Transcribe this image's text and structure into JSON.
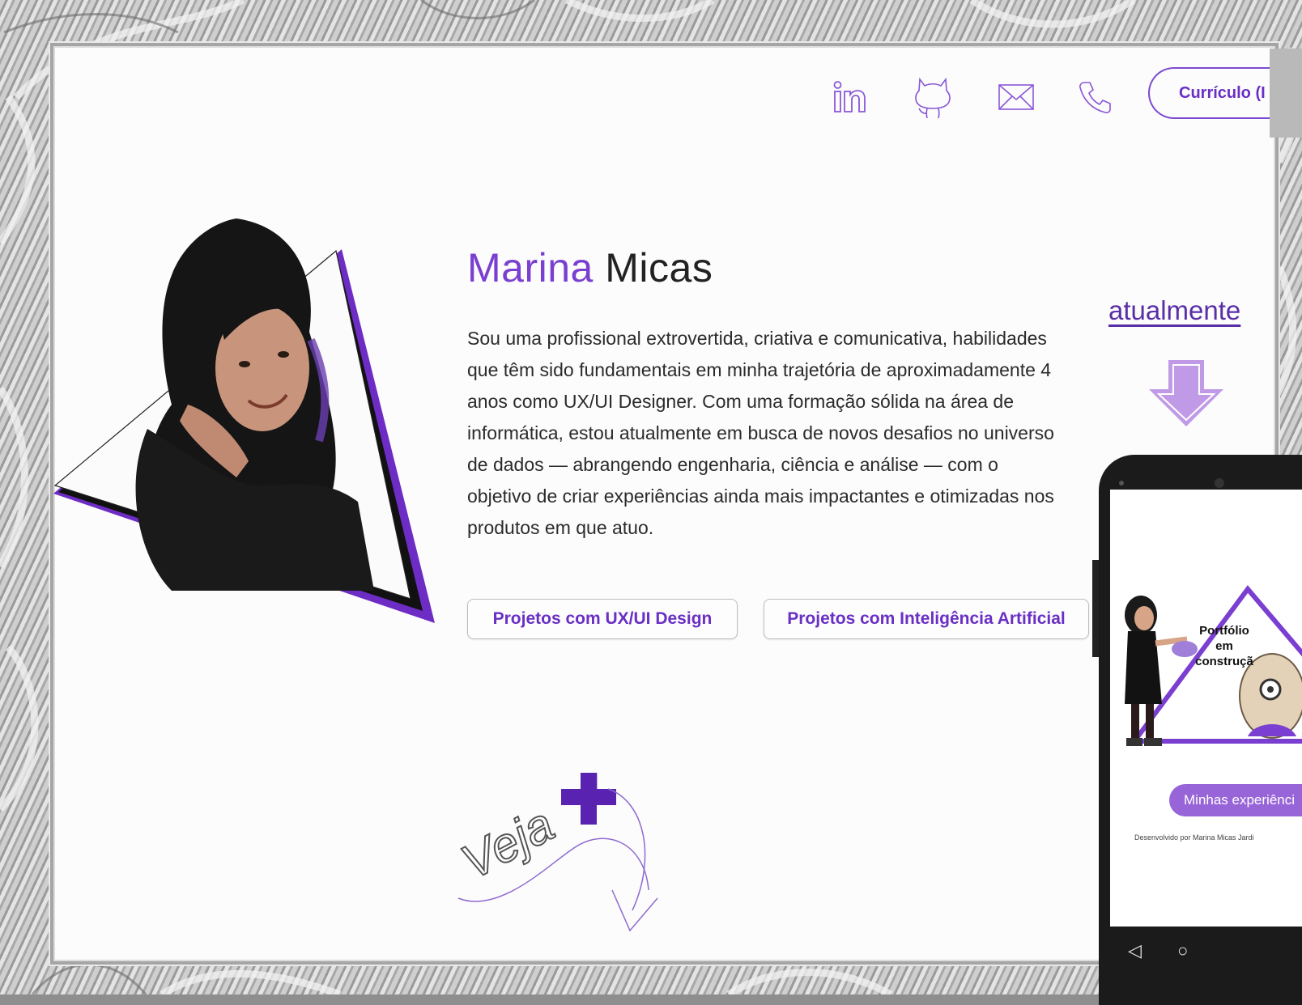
{
  "header": {
    "social": [
      {
        "name": "linkedin-icon"
      },
      {
        "name": "github-icon"
      },
      {
        "name": "mail-icon"
      },
      {
        "name": "phone-icon"
      }
    ],
    "cv_button_label": "Currículo (I"
  },
  "profile": {
    "first_name": "Marina",
    "last_name": "Micas",
    "bio": "Sou uma profissional extrovertida, criativa e comunicativa, habilidades que têm sido fundamentais em minha trajetória de aproximadamente 4 anos como UX/UI Designer. Com uma formação sólida na área de informática, estou atualmente em busca de novos desafios no universo de dados — abrangendo engenharia, ciência e análise — com o objetivo de criar experiências ainda mais impactantes e otimizadas nos produtos em que atuo.",
    "buttons": {
      "ux_ui": "Projetos com UX/UI Design",
      "ai": "Projetos com Inteligência Artificial"
    }
  },
  "veja": {
    "text": "Veja",
    "plus": "+"
  },
  "right": {
    "currently_link": "atualmente",
    "phone": {
      "badge_lines": [
        "Portfólio",
        "em",
        "construçã"
      ],
      "experience_button": "Minhas experiênci",
      "dev_note": "Desenvolvido por Marina Micas Jardi",
      "nav": [
        "◁",
        "○"
      ]
    }
  },
  "colors": {
    "accent": "#7a3fd1",
    "button_text": "#6a2fc4",
    "phone_button": "#9865d8"
  }
}
